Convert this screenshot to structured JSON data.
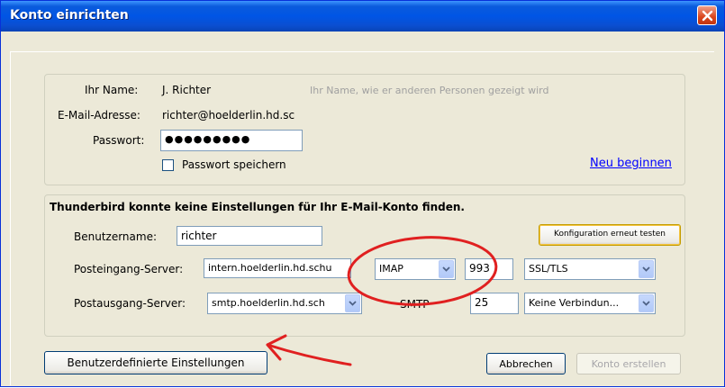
{
  "window": {
    "title": "Konto einrichten",
    "close_icon": "close-icon"
  },
  "account": {
    "name_label": "Ihr Name:",
    "name_value": "J. Richter",
    "name_hint": "Ihr Name, wie er anderen Personen gezeigt wird",
    "email_label": "E-Mail-Adresse:",
    "email_value": "richter@hoelderlin.hd.sc",
    "password_label": "Passwort:",
    "password_value": "●●●●●●●●●",
    "remember_label": "Passwort speichern",
    "remember_checked": false,
    "restart_link": "Neu beginnen"
  },
  "config": {
    "message": "Thunderbird konnte keine Einstellungen für Ihr E-Mail-Konto finden.",
    "username_label": "Benutzername:",
    "username_value": "richter",
    "retest_button": "Konfiguration erneut testen",
    "incoming_label": "Posteingang-Server:",
    "incoming_value": "intern.hoelderlin.hd.schu",
    "incoming_protocol": "IMAP",
    "incoming_port": "993",
    "incoming_security": "SSL/TLS",
    "outgoing_label": "Postausgang-Server:",
    "outgoing_value": "smtp.hoelderlin.hd.sch",
    "outgoing_protocol": "SMTP",
    "outgoing_port": "25",
    "outgoing_security": "Keine Verbindun..."
  },
  "footer": {
    "advanced_button": "Benutzerdefinierte Einstellungen",
    "cancel_button": "Abbrechen",
    "create_button": "Konto erstellen"
  },
  "annotations": {
    "circle_color": "#e02020",
    "arrow_color": "#e02020"
  },
  "colors": {
    "titlebar": "#0055e5",
    "dialog_bg": "#ece9d8",
    "link": "#0000ff"
  }
}
